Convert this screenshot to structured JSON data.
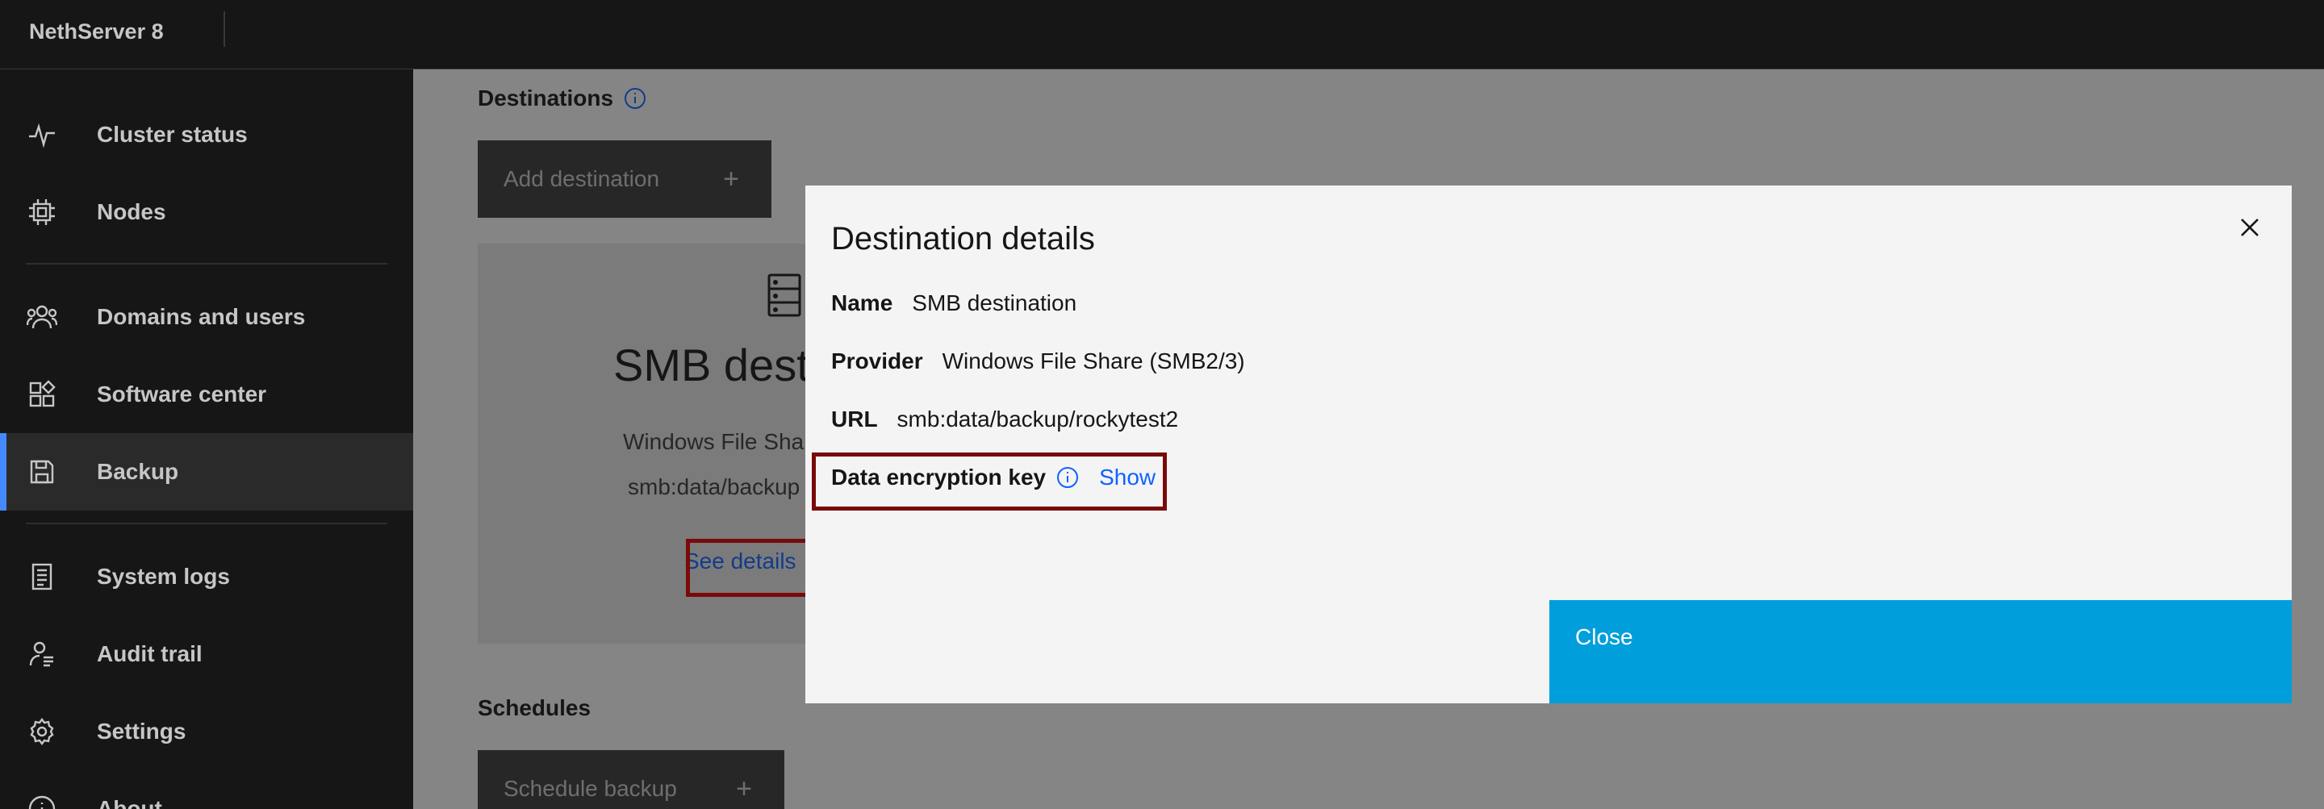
{
  "header": {
    "brand": "NethServer 8"
  },
  "sidebar": {
    "items": [
      {
        "label": "Cluster status",
        "icon": "activity-icon"
      },
      {
        "label": "Nodes",
        "icon": "chip-icon"
      },
      {
        "label": "Domains and users",
        "icon": "users-icon"
      },
      {
        "label": "Software center",
        "icon": "apps-icon"
      },
      {
        "label": "Backup",
        "icon": "save-icon"
      },
      {
        "label": "System logs",
        "icon": "logs-icon"
      },
      {
        "label": "Audit trail",
        "icon": "audit-icon"
      },
      {
        "label": "Settings",
        "icon": "gear-icon"
      },
      {
        "label": "About",
        "icon": "info-icon"
      }
    ],
    "active": "Backup"
  },
  "main": {
    "destinations_title": "Destinations",
    "add_destination": "Add destination",
    "card": {
      "title": "SMB dest",
      "provider": "Windows File Sha",
      "url": "smb:data/backup",
      "details_link": "See details"
    },
    "schedules_title": "Schedules",
    "schedule_backup": "Schedule backup"
  },
  "modal": {
    "title": "Destination details",
    "name_label": "Name",
    "name_value": "SMB destination",
    "provider_label": "Provider",
    "provider_value": "Windows File Share (SMB2/3)",
    "url_label": "URL",
    "url_value": "smb:data/backup/rockytest2",
    "key_label": "Data encryption key",
    "key_show": "Show",
    "close_button": "Close"
  },
  "colors": {
    "accent": "#009fdb",
    "link": "#0f62fe",
    "highlight": "#7a0a0a"
  }
}
